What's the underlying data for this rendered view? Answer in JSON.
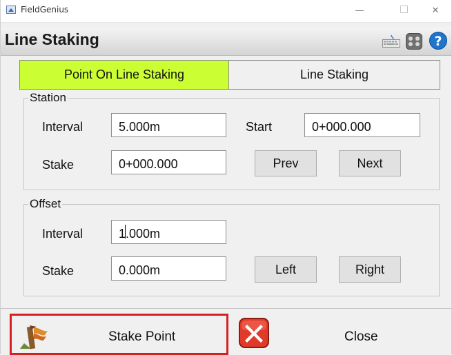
{
  "window": {
    "title": "FieldGenius"
  },
  "header": {
    "title": "Line Staking"
  },
  "tabs": [
    {
      "label": "Point On Line Staking",
      "active": true
    },
    {
      "label": "Line Staking",
      "active": false
    }
  ],
  "station": {
    "title": "Station",
    "interval_label": "Interval",
    "interval_value": "5.000m",
    "start_label": "Start",
    "start_value": "0+000.000",
    "stake_label": "Stake",
    "stake_value": "0+000.000",
    "prev_label": "Prev",
    "next_label": "Next"
  },
  "offset": {
    "title": "Offset",
    "interval_label": "Interval",
    "interval_value": "1.000m",
    "stake_label": "Stake",
    "stake_value": "0.000m",
    "left_label": "Left",
    "right_label": "Right"
  },
  "actions": {
    "stake_point_label": "Stake Point",
    "close_label": "Close"
  },
  "colors": {
    "active_tab": "#ccff33",
    "highlight_border": "#d42020",
    "help_icon": "#1f74cc"
  }
}
